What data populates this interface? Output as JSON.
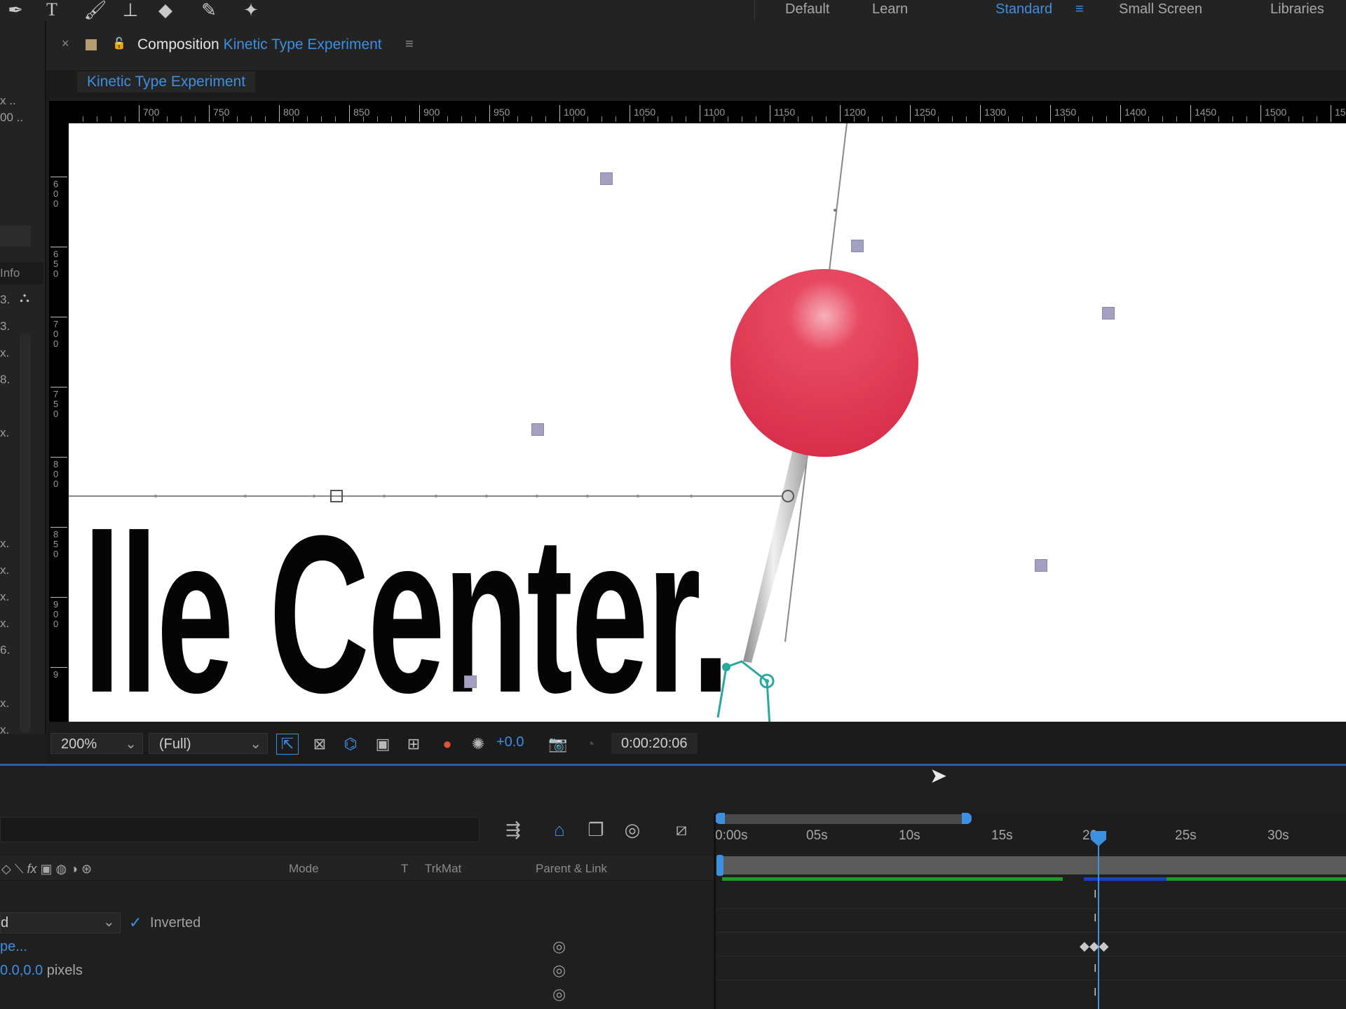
{
  "toolbar": {
    "tools": [
      "pen-tool",
      "type-tool",
      "brush-tool",
      "clone-stamp-tool",
      "eraser-tool",
      "roto-brush-tool",
      "puppet-pin-tool"
    ],
    "workspaces": {
      "default": "Default",
      "learn": "Learn",
      "standard": "Standard",
      "small_screen": "Small Screen",
      "libraries": "Libraries"
    }
  },
  "left_panel": {
    "top_rows": [
      "x ..",
      "00 .."
    ],
    "info_tab": "Info",
    "rows": [
      "3.",
      "3.",
      "x.",
      "8.",
      "x.",
      "x.",
      "x.",
      "x.",
      "x.",
      "6.",
      "x.",
      "x."
    ]
  },
  "composition": {
    "tab_prefix": "Composition",
    "tab_name": "Kinetic Type Experiment",
    "breadcrumb": "Kinetic Type Experiment",
    "ruler_h": [
      "700",
      "750",
      "800",
      "850",
      "900",
      "950",
      "1000",
      "1050",
      "1100",
      "1150",
      "1200",
      "1250",
      "1300",
      "1350",
      "1400",
      "1450",
      "1500",
      "15"
    ],
    "ruler_v": [
      "600",
      "650",
      "700",
      "750",
      "800",
      "850",
      "900",
      "9"
    ],
    "canvas_text": "lle Center.",
    "accent_red": "#e03a52"
  },
  "viewer_footer": {
    "zoom": "200%",
    "resolution": "(Full)",
    "exposure": "+0.0",
    "timecode": "0:00:20:06"
  },
  "timeline": {
    "columns": {
      "mode": "Mode",
      "t": "T",
      "trkmat": "TrkMat",
      "parent": "Parent & Link"
    },
    "time_labels": [
      "0:00s",
      "05s",
      "10s",
      "15s",
      "20s",
      "25s",
      "30s"
    ],
    "rows": {
      "mask_mode_value": "d",
      "inverted_label": "Inverted",
      "shape_link": "pe...",
      "feather_value": "0.0,0.0",
      "feather_unit": "pixels"
    }
  }
}
